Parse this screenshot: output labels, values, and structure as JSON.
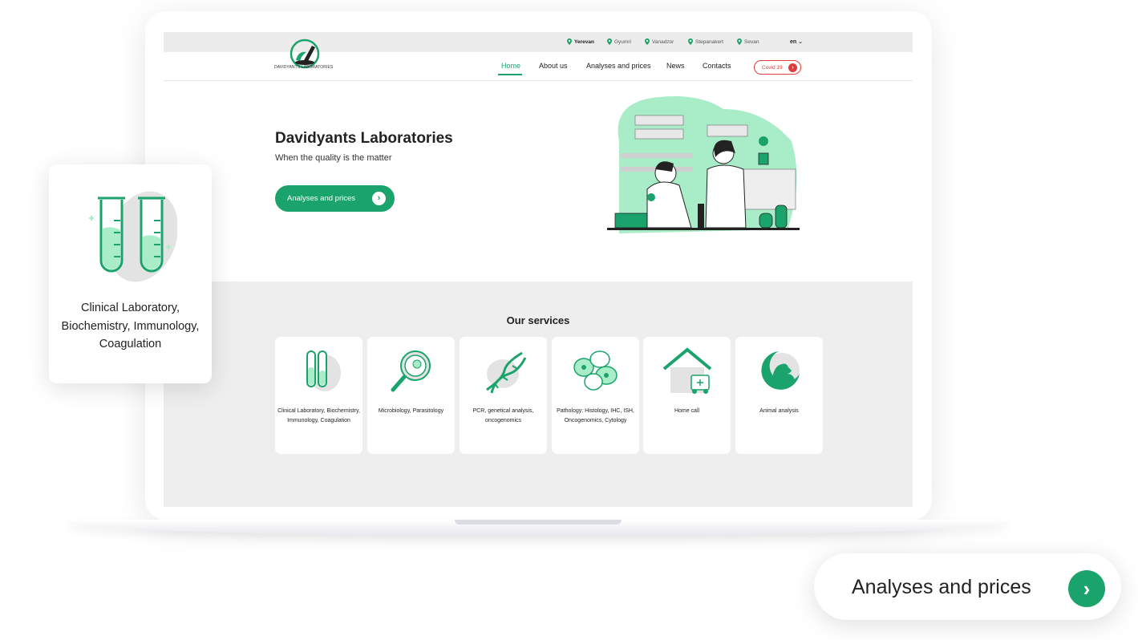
{
  "topbar": {
    "cities": [
      {
        "name": "Yerevan",
        "active": true
      },
      {
        "name": "Gyumri",
        "active": false
      },
      {
        "name": "Vanadzor",
        "active": false
      },
      {
        "name": "Stepanakert",
        "active": false
      },
      {
        "name": "Sevan",
        "active": false
      }
    ],
    "lang": "en ⌄"
  },
  "nav": {
    "logo_text": "DAVIDYANTS LABORATORIES",
    "items": [
      "Home",
      "About us",
      "Analyses and prices",
      "News",
      "Contacts"
    ],
    "active": "Home",
    "covid_label": "Covid 19"
  },
  "hero": {
    "title": "Davidyants Laboratories",
    "subtitle": "When the quality is the matter",
    "button_label": "Analyses and prices"
  },
  "services": {
    "title": "Our services",
    "items": [
      {
        "label": "Clinical Laboratory, Biochemistry, Immunology, Coagulation",
        "icon": "test-tubes-icon"
      },
      {
        "label": "Microbiology, Parasitology",
        "icon": "magnifier-icon"
      },
      {
        "label": "PCR, genetical analysis, oncogenomics",
        "icon": "dna-icon"
      },
      {
        "label": "Pathology: Histology, IHC, ISH, Oncogenomics, Cytology",
        "icon": "cells-icon"
      },
      {
        "label": "Home call",
        "icon": "home-ambulance-icon"
      },
      {
        "label": "Animal analysis",
        "icon": "animal-icon"
      }
    ]
  },
  "float_card": {
    "label": "Clinical Laboratory, Biochemistry, Immunology, Coagulation"
  },
  "float_button": {
    "label": "Analyses and prices"
  },
  "colors": {
    "accent": "#1aa36b",
    "covid": "#e23b3b",
    "services_bg": "#eeeeee"
  }
}
